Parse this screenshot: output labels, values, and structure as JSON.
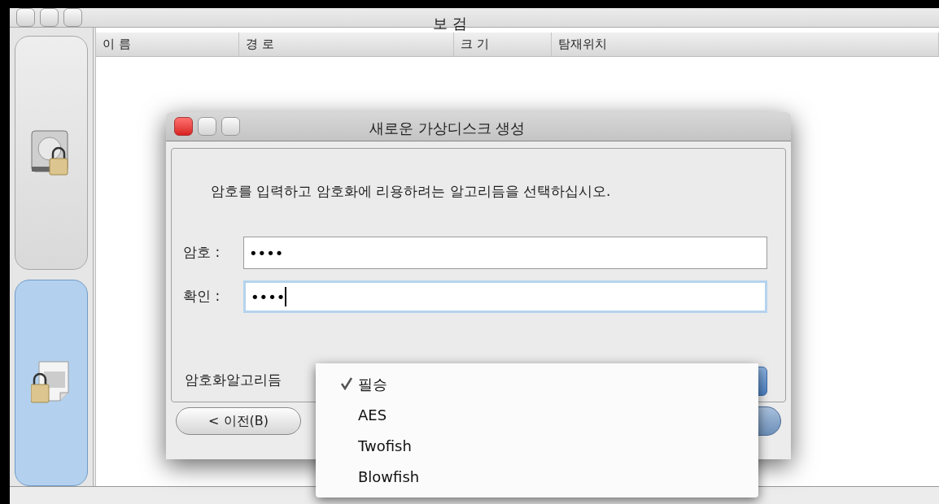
{
  "window": {
    "title": "보 검"
  },
  "sidebar": {
    "items": [
      {
        "kind": "disk",
        "selected": false
      },
      {
        "kind": "file",
        "selected": true
      }
    ]
  },
  "table": {
    "columns": [
      "이 름",
      "경 로",
      "크 기",
      "탐재위치"
    ]
  },
  "dialog": {
    "title": "새로운 가상디스크 생성",
    "message": "암호를 입력하고 암호화에 리용하려는 알고리듬을 선택하십시오.",
    "fields": [
      {
        "label": "암호 :",
        "value": "••••",
        "focused": false
      },
      {
        "label": "확인 :",
        "value": "••••",
        "focused": true
      }
    ],
    "algorithm_label": "암호화알고리듬",
    "back_button": "< 이전(B)"
  },
  "popup_menu": {
    "items": [
      {
        "label": "필승",
        "checked": true
      },
      {
        "label": "AES",
        "checked": false
      },
      {
        "label": "Twofish",
        "checked": false
      },
      {
        "label": "Blowfish",
        "checked": false
      }
    ]
  }
}
